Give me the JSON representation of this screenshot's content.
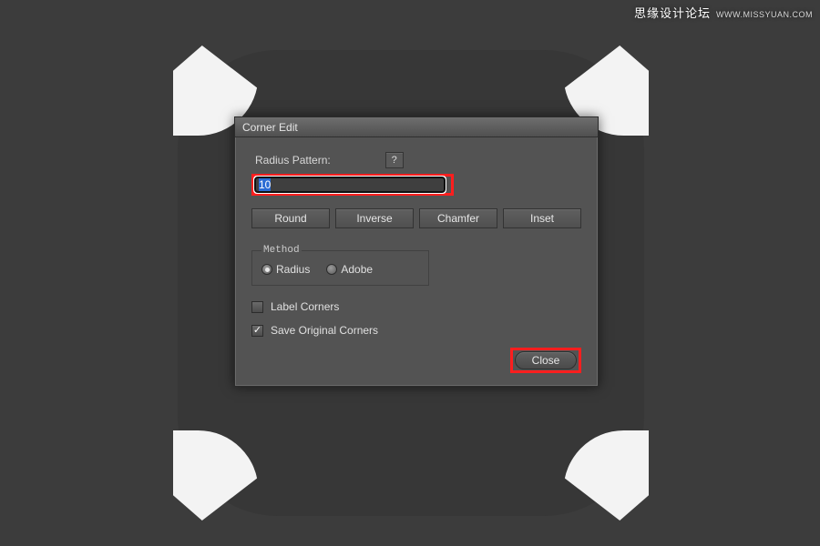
{
  "watermark": {
    "text": "思缘设计论坛",
    "url": "WWW.MISSYUAN.COM"
  },
  "dialog": {
    "title": "Corner Edit",
    "radius_label": "Radius Pattern:",
    "help_label": "?",
    "radius_value": "10",
    "buttons": {
      "round": "Round",
      "inverse": "Inverse",
      "chamfer": "Chamfer",
      "inset": "Inset"
    },
    "method": {
      "legend": "Method",
      "radius": "Radius",
      "adobe": "Adobe",
      "selected": "radius"
    },
    "label_corners": "Label Corners",
    "label_corners_checked": false,
    "save_original": "Save Original Corners",
    "save_original_checked": true,
    "close": "Close"
  }
}
